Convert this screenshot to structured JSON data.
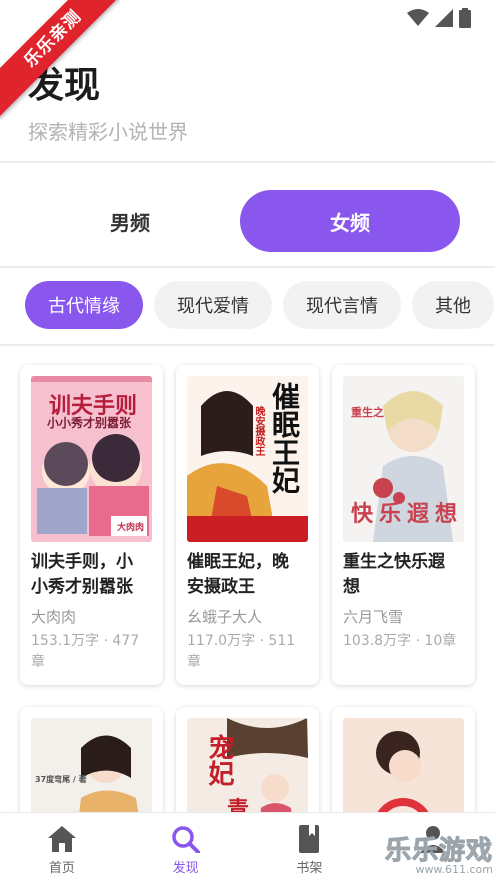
{
  "ribbon": "乐乐亲测",
  "header": {
    "title": "发现",
    "subtitle": "探索精彩小说世界"
  },
  "gender_tabs": [
    {
      "label": "男频",
      "active": false
    },
    {
      "label": "女频",
      "active": true
    }
  ],
  "categories": [
    {
      "label": "古代情缘",
      "active": true
    },
    {
      "label": "现代爱情",
      "active": false
    },
    {
      "label": "现代言情",
      "active": false
    },
    {
      "label": "其他",
      "active": false
    }
  ],
  "books": [
    {
      "title_line1": "训夫手则，小",
      "title_line2": "小秀才别嚣张",
      "author": "大肉肉",
      "meta_line1": "153.1万字 · 477",
      "meta_line2": "章",
      "cover_text1": "训夫手则",
      "cover_text2": "小小秀才别嚣张",
      "cover_tag": "大肉肉"
    },
    {
      "title_line1": "催眠王妃，晚",
      "title_line2": "安摄政王",
      "author": "幺蛾子大人",
      "meta_line1": "117.0万字 · 511",
      "meta_line2": "章",
      "cover_text1": "催眠王妃",
      "cover_text2": "晚安摄政王"
    },
    {
      "title_line1": "重生之快乐遐",
      "title_line2": "想",
      "author": "六月飞雪",
      "meta_line1": "103.8万字 · 10章",
      "meta_line2": "",
      "cover_text1": "重生之",
      "cover_text2": "快乐遐想"
    },
    {
      "cover_text1": "37度弯尾 / 著"
    },
    {
      "cover_text1": "宠妃",
      "cover_text2": "青"
    },
    {}
  ],
  "nav": [
    {
      "label": "首页",
      "icon": "home-icon",
      "active": false
    },
    {
      "label": "发现",
      "icon": "search-icon",
      "active": true
    },
    {
      "label": "书架",
      "icon": "bookshelf-icon",
      "active": false
    }
  ],
  "watermark": {
    "main": "乐乐游戏",
    "url": "www.611.com"
  },
  "colors": {
    "accent": "#8a57ee",
    "ribbon": "#e0242b"
  }
}
